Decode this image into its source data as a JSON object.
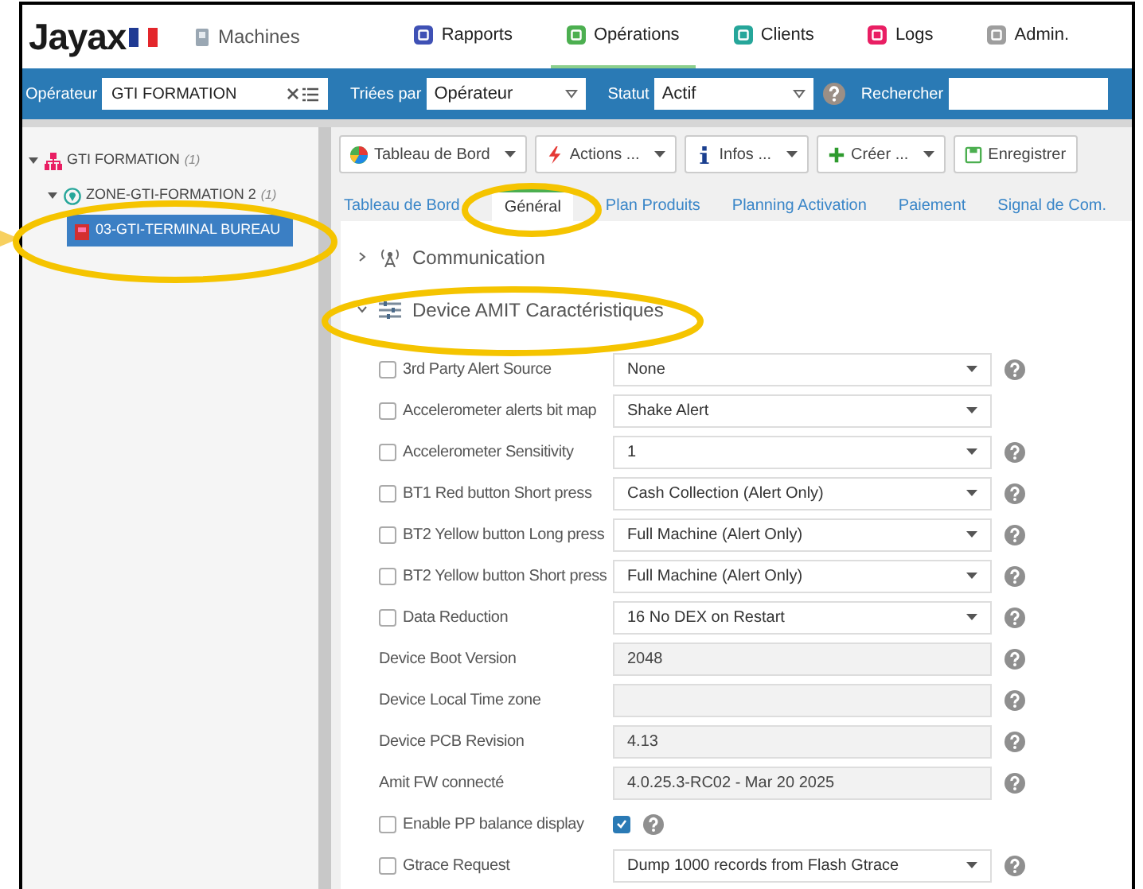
{
  "header": {
    "logo": "Jayax",
    "section": "Machines",
    "nav": [
      {
        "label": "Rapports",
        "selected": false,
        "color": "#3f51b5"
      },
      {
        "label": "Opérations",
        "selected": true,
        "color": "#4caf50"
      },
      {
        "label": "Clients",
        "selected": false,
        "color": "#26a69a"
      },
      {
        "label": "Logs",
        "selected": false,
        "color": "#e91e63"
      },
      {
        "label": "Admin.",
        "selected": false,
        "color": "#9e9e9e"
      }
    ]
  },
  "filters": {
    "operator_label": "Opérateur",
    "operator_value": "GTI FORMATION",
    "sort_label": "Triées par",
    "sort_value": "Opérateur",
    "status_label": "Statut",
    "status_value": "Actif",
    "search_label": "Rechercher"
  },
  "tree": [
    {
      "label": "GTI FORMATION",
      "count": "(1)",
      "selected": false,
      "expanded": true,
      "children": [
        {
          "label": "ZONE-GTI-FORMATION 2",
          "count": "(1)",
          "selected": false,
          "expanded": true,
          "children": [
            {
              "label": "03-GTI-TERMINAL BUREAU",
              "selected": true
            }
          ]
        }
      ]
    }
  ],
  "toolbar": [
    {
      "label": "Tableau de Bord",
      "dropdown": true
    },
    {
      "label": "Actions ...",
      "dropdown": true
    },
    {
      "label": "Infos ...",
      "dropdown": true
    },
    {
      "label": "Créer ...",
      "dropdown": true
    },
    {
      "label": "Enregistrer",
      "dropdown": false
    }
  ],
  "tabs": [
    {
      "label": "Tableau de Bord",
      "selected": false
    },
    {
      "label": "Général",
      "selected": true
    },
    {
      "label": "Plan Produits",
      "selected": false
    },
    {
      "label": "Planning Activation",
      "selected": false
    },
    {
      "label": "Paiement",
      "selected": false
    },
    {
      "label": "Signal de Com.",
      "selected": false
    }
  ],
  "sections": [
    {
      "title": "Communication",
      "expanded": false
    },
    {
      "title": "Device AMIT Caractéristiques",
      "expanded": true
    }
  ],
  "fields": [
    {
      "label": "3rd Party Alert Source",
      "checkbox": {
        "checked": false
      },
      "kind": "select",
      "value": "None",
      "help": true
    },
    {
      "label": "Accelerometer alerts bit map",
      "checkbox": {
        "checked": false
      },
      "kind": "select",
      "value": "Shake Alert",
      "help": false
    },
    {
      "label": "Accelerometer Sensitivity",
      "checkbox": {
        "checked": false
      },
      "kind": "select",
      "value": "1",
      "help": true
    },
    {
      "label": "BT1 Red button Short press",
      "checkbox": {
        "checked": false
      },
      "kind": "select",
      "value": "Cash Collection (Alert Only)",
      "help": true
    },
    {
      "label": "BT2 Yellow button Long press",
      "checkbox": {
        "checked": false
      },
      "kind": "select",
      "value": "Full Machine (Alert Only)",
      "help": true
    },
    {
      "label": "BT2 Yellow button Short press",
      "checkbox": {
        "checked": false
      },
      "kind": "select",
      "value": "Full Machine (Alert Only)",
      "help": true
    },
    {
      "label": "Data Reduction",
      "checkbox": {
        "checked": false
      },
      "kind": "select",
      "value": "16 No DEX on Restart",
      "help": true
    },
    {
      "label": "Device Boot Version",
      "kind": "readonly",
      "value": "2048",
      "help": true
    },
    {
      "label": "Device Local Time zone",
      "kind": "readonly",
      "help": true
    },
    {
      "label": "Device PCB Revision",
      "kind": "readonly",
      "value": "4.13",
      "help": true
    },
    {
      "label": "Amit FW connecté",
      "kind": "readonly",
      "value": "4.0.25.3-RC02 - Mar 20 2025",
      "help": true
    },
    {
      "label": "Enable PP balance display",
      "checkbox": {
        "checked": false
      },
      "kind": "check",
      "checked": true,
      "help": true
    },
    {
      "label": "Gtrace Request",
      "checkbox": {
        "checked": false
      },
      "kind": "select",
      "value": "Dump 1000 records from Flash Gtrace",
      "help": true
    }
  ]
}
